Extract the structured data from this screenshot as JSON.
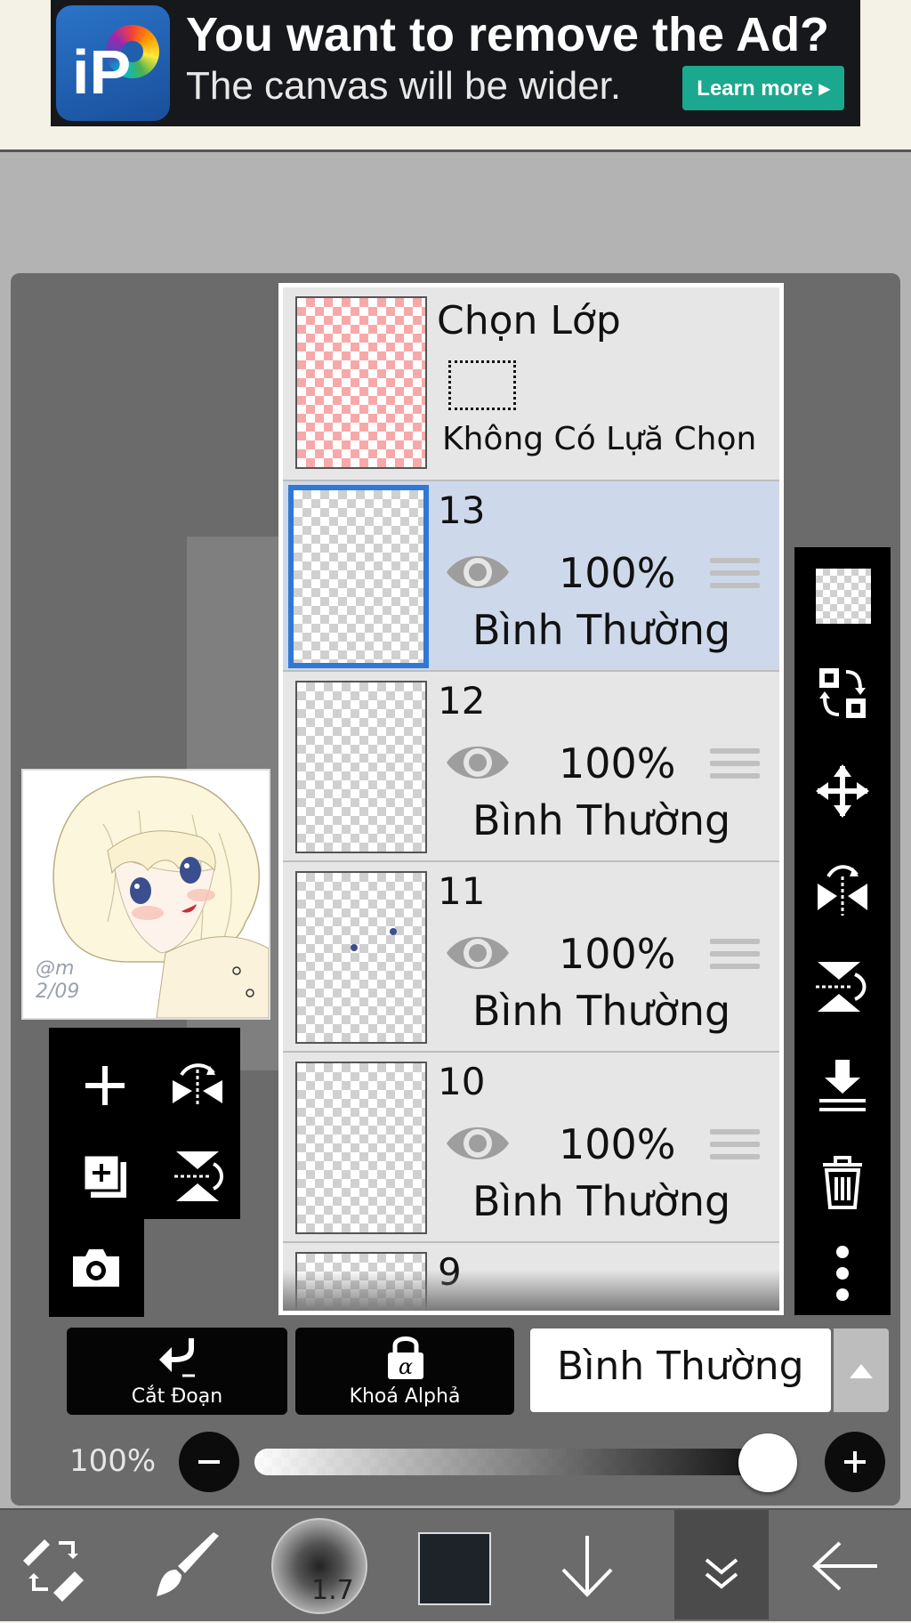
{
  "ad": {
    "title": "You want to remove the Ad?",
    "subtitle": "The canvas will be wider.",
    "button": "Learn more ▸",
    "logo_letters": "iP"
  },
  "layer_panel": {
    "selection": {
      "title": "Chọn Lớp",
      "status": "Không Có Lựă Chọn"
    },
    "layers": [
      {
        "number": "13",
        "opacity": "100%",
        "blend": "Bình Thường",
        "active": true
      },
      {
        "number": "12",
        "opacity": "100%",
        "blend": "Bình Thường",
        "active": false
      },
      {
        "number": "11",
        "opacity": "100%",
        "blend": "Bình Thường",
        "active": false
      },
      {
        "number": "10",
        "opacity": "100%",
        "blend": "Bình Thường",
        "active": false
      },
      {
        "number": "9",
        "opacity": "",
        "blend": "",
        "active": false
      }
    ]
  },
  "controls": {
    "clipping_label": "Cắt Đoạn",
    "alpha_lock_label": "Khoá Alphả",
    "blend_mode": "Bình Thường",
    "opacity_label": "100%",
    "opacity_value": 1.0
  },
  "thumbnail": {
    "signature": "@m 2/09"
  },
  "toolbar": {
    "brush_size": "1.7",
    "current_color": "#1d2329"
  },
  "colors": {
    "active_layer_bg": "#cdd9eb",
    "active_layer_border": "#2f78d6",
    "ad_button": "#1aa88e",
    "panel_bg": "#6b6b6b"
  }
}
